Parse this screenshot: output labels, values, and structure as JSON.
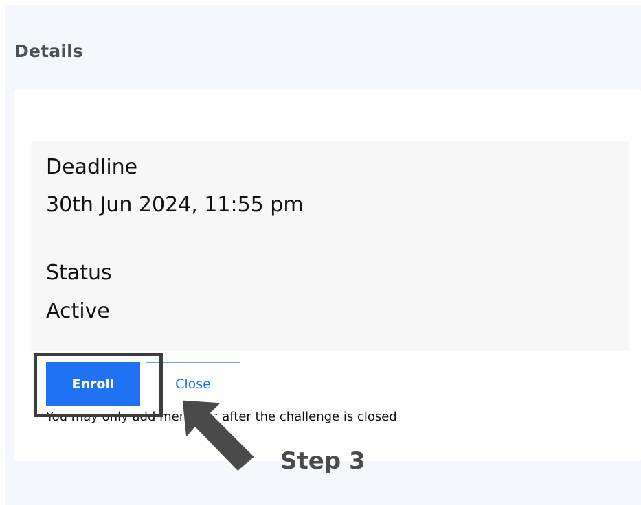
{
  "section": {
    "title": "Details"
  },
  "details": {
    "deadline_label": "Deadline",
    "deadline_value": "30th Jun 2024, 11:55 pm",
    "status_label": "Status",
    "status_value": "Active"
  },
  "actions": {
    "enroll_label": "Enroll",
    "close_label": "Close"
  },
  "note": "You may only add members after the challenge is closed",
  "annotation": {
    "step_label": "Step 3",
    "arrow_icon": "arrow-up-left-icon"
  },
  "colors": {
    "primary": "#1f73f2",
    "page_bg": "#f4f8fc",
    "annotation": "#3d3d3d"
  }
}
